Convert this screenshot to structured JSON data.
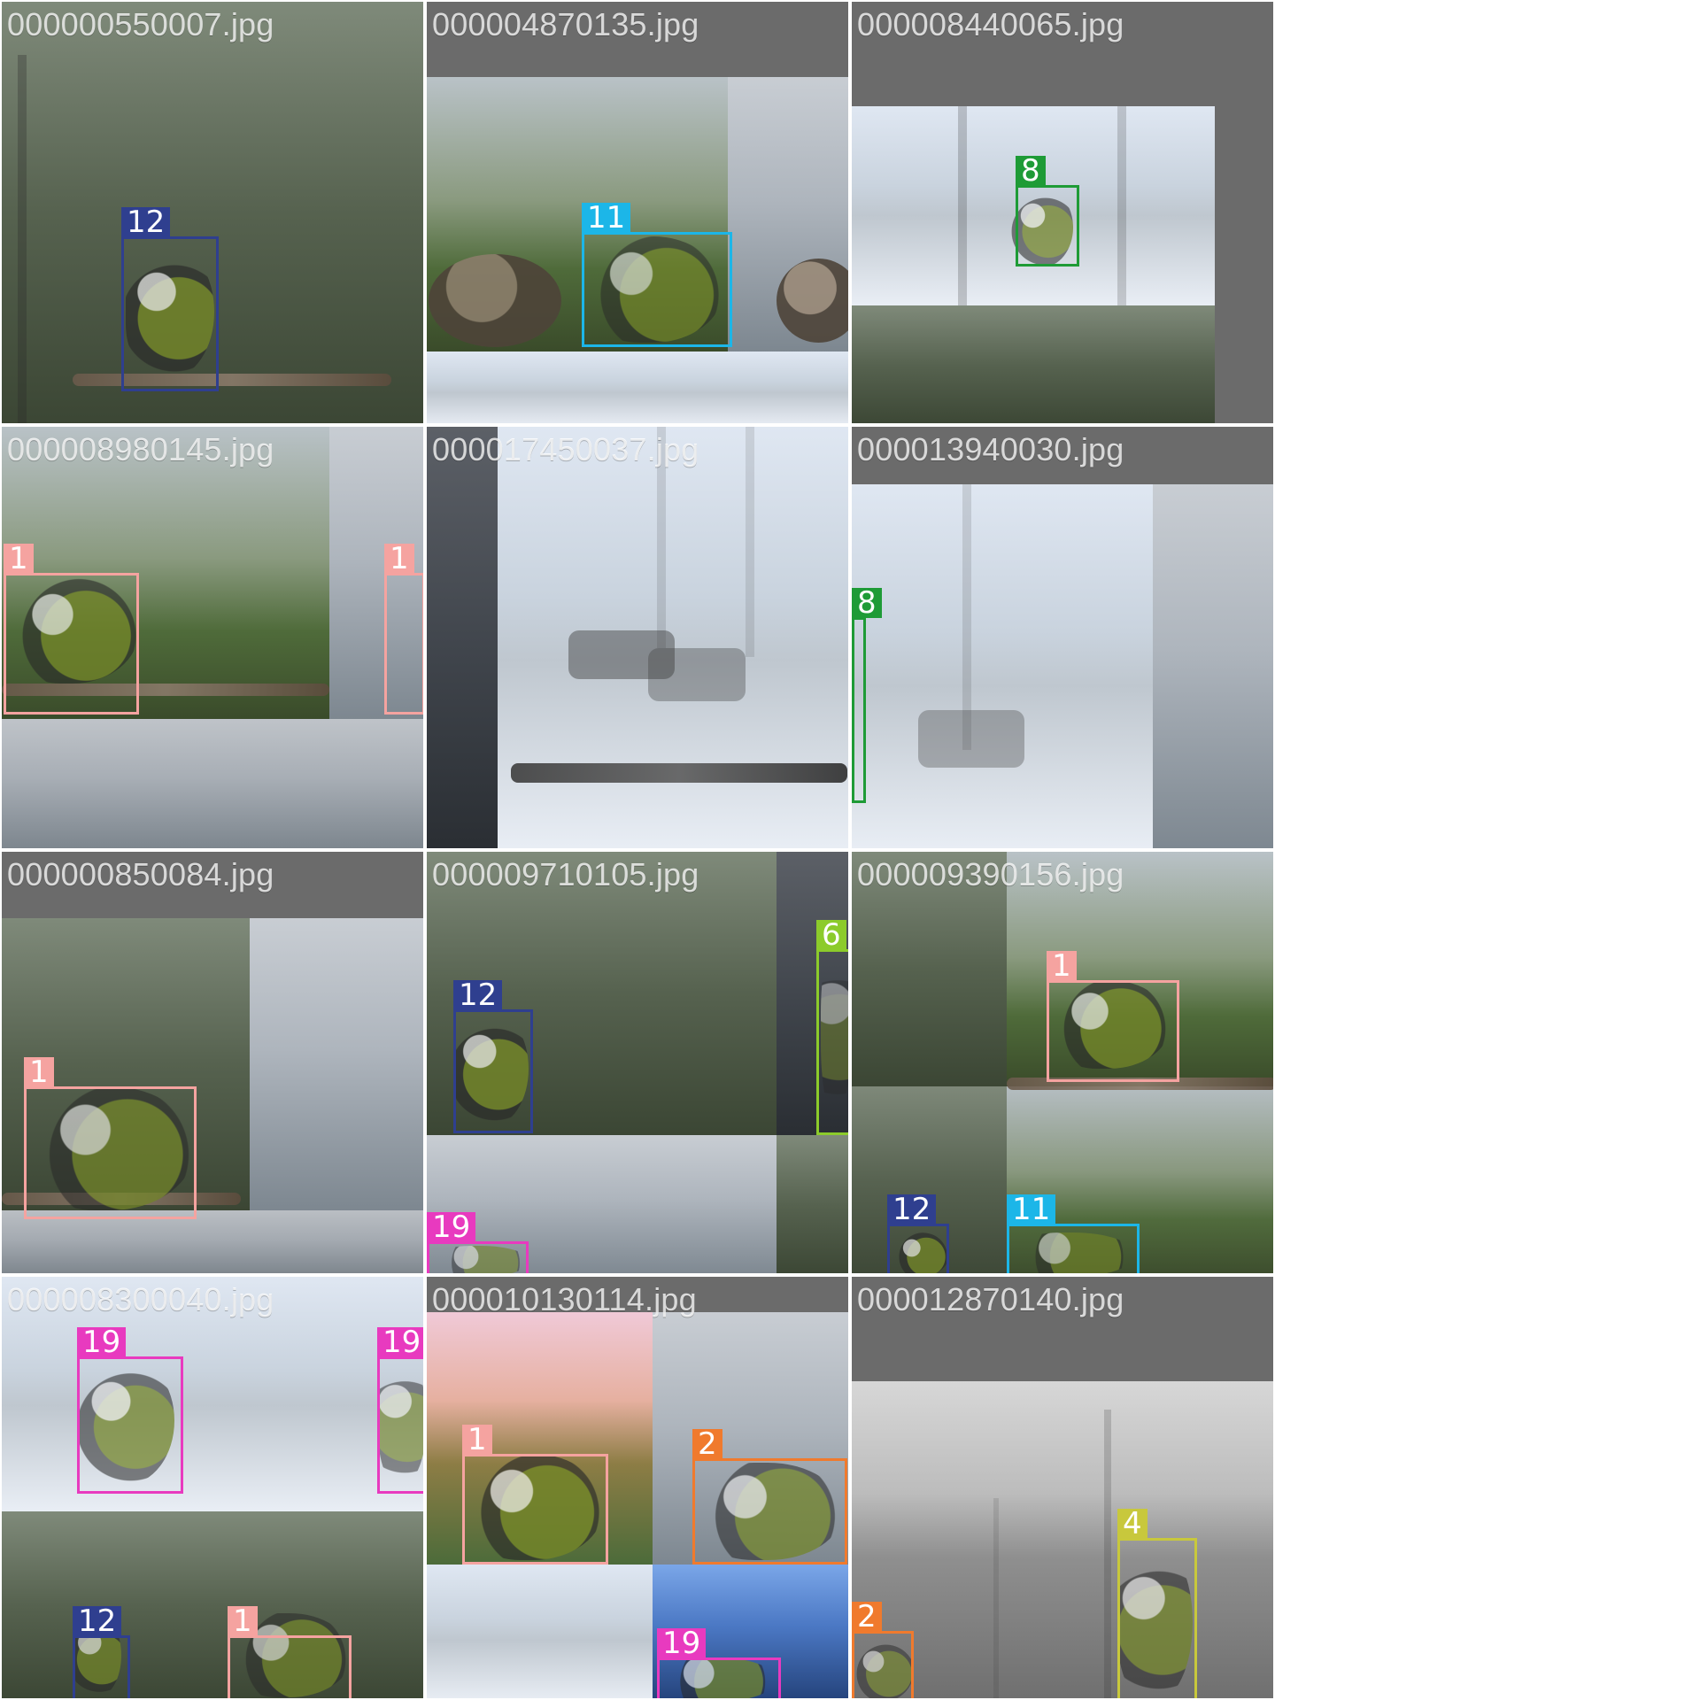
{
  "tiles": [
    {
      "filename": "000000550007.jpg",
      "detections": [
        {
          "label": "12",
          "color": "#2F3F8F"
        }
      ]
    },
    {
      "filename": "000004870135.jpg",
      "detections": [
        {
          "label": "11",
          "color": "#1CB6E8"
        }
      ]
    },
    {
      "filename": "000008440065.jpg",
      "detections": [
        {
          "label": "8",
          "color": "#1E9B36"
        }
      ]
    },
    {
      "filename": "000008980145.jpg",
      "detections": [
        {
          "label": "1",
          "color": "#F5A3A0"
        },
        {
          "label": "1",
          "color": "#F5A3A0"
        }
      ]
    },
    {
      "filename": "000017450037.jpg",
      "detections": []
    },
    {
      "filename": "000013940030.jpg",
      "detections": [
        {
          "label": "8",
          "color": "#1E9B36"
        }
      ]
    },
    {
      "filename": "000000850084.jpg",
      "detections": [
        {
          "label": "1",
          "color": "#F5A3A0"
        }
      ]
    },
    {
      "filename": "000009710105.jpg",
      "detections": [
        {
          "label": "12",
          "color": "#2F3F8F"
        },
        {
          "label": "6",
          "color": "#8CCB2B"
        },
        {
          "label": "19",
          "color": "#E83ABF"
        }
      ]
    },
    {
      "filename": "000009390156.jpg",
      "detections": [
        {
          "label": "1",
          "color": "#F5A3A0"
        },
        {
          "label": "12",
          "color": "#2F3F8F"
        },
        {
          "label": "11",
          "color": "#1CB6E8"
        }
      ]
    },
    {
      "filename": "000008300040.jpg",
      "detections": [
        {
          "label": "19",
          "color": "#E83ABF"
        },
        {
          "label": "19",
          "color": "#E83ABF"
        },
        {
          "label": "12",
          "color": "#2F3F8F"
        },
        {
          "label": "1",
          "color": "#F5A3A0"
        }
      ]
    },
    {
      "filename": "000010130114.jpg",
      "detections": [
        {
          "label": "1",
          "color": "#F5A3A0"
        },
        {
          "label": "2",
          "color": "#F07A2D"
        },
        {
          "label": "19",
          "color": "#E83ABF"
        }
      ]
    },
    {
      "filename": "000012870140.jpg",
      "detections": [
        {
          "label": "2",
          "color": "#F07A2D"
        },
        {
          "label": "4",
          "color": "#C8C83C"
        }
      ]
    }
  ]
}
